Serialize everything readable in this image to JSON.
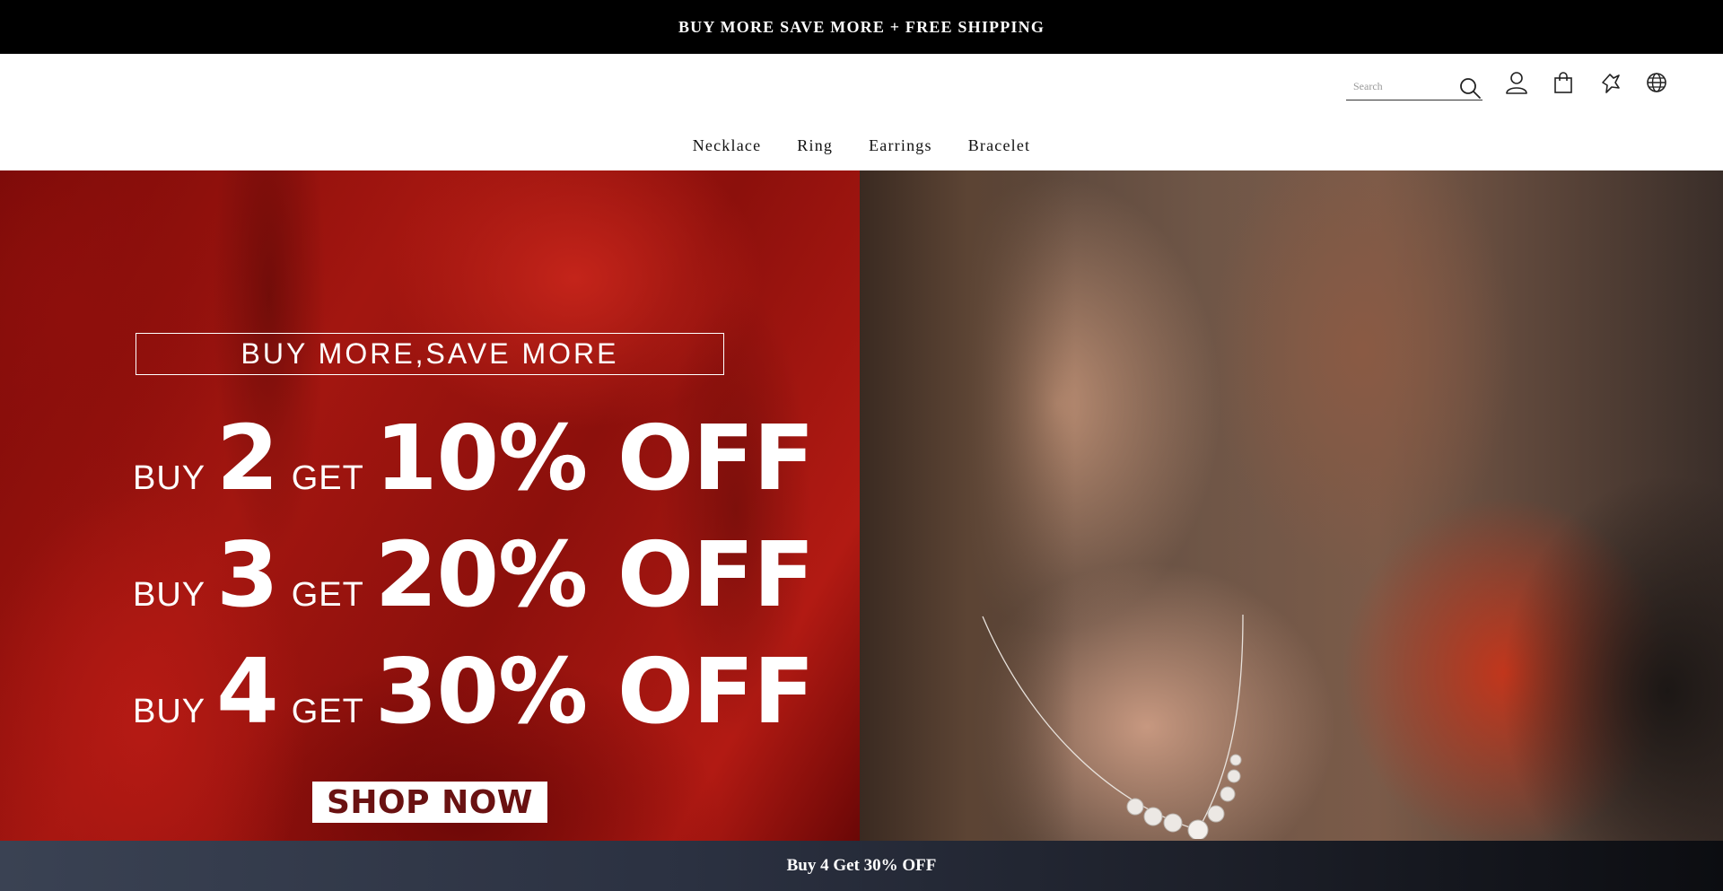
{
  "announcement": {
    "text": "BUY MORE SAVE MORE + FREE SHIPPING"
  },
  "header": {
    "search": {
      "placeholder": "Search",
      "value": ""
    },
    "icons": [
      "search-icon",
      "account-icon",
      "cart-icon",
      "wishlist-icon",
      "language-icon"
    ]
  },
  "nav": {
    "items": [
      "Necklace",
      "Ring",
      "Earrings",
      "Bracelet"
    ]
  },
  "hero": {
    "headline": "BUY MORE,SAVE MORE",
    "offers": [
      {
        "buy_word": "BUY",
        "qty": "2",
        "get_word": "GET",
        "discount": "10% OFF"
      },
      {
        "buy_word": "BUY",
        "qty": "3",
        "get_word": "GET",
        "discount": "20% OFF"
      },
      {
        "buy_word": "BUY",
        "qty": "4",
        "get_word": "GET",
        "discount": "30% OFF"
      }
    ],
    "cta": "SHOP NOW"
  },
  "bottom_bar": {
    "text": "Buy 4 Get 30% OFF"
  },
  "colors": {
    "announcement_bg": "#000000",
    "hero_red": "#a31610",
    "cta_text": "#6a1212"
  }
}
